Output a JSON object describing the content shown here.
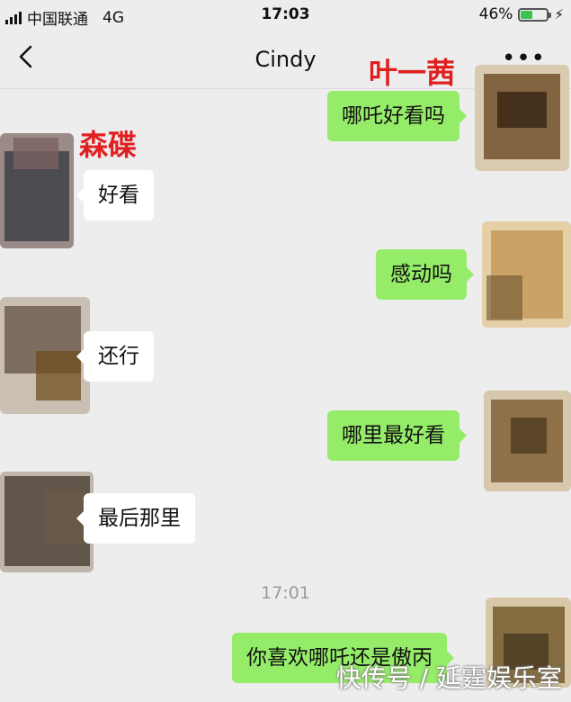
{
  "status_bar": {
    "carrier": "中国联通",
    "network": "4G",
    "time": "17:03",
    "battery_text": "46%",
    "battery_level": 0.46
  },
  "header": {
    "title": "Cindy",
    "back_icon": "chevron-left-icon",
    "more_icon": "more-dots-icon"
  },
  "annotations": {
    "left_name": "森碟",
    "right_name": "叶一茜"
  },
  "messages": [
    {
      "side": "right",
      "text": "哪吒好看吗"
    },
    {
      "side": "left",
      "text": "好看"
    },
    {
      "side": "right",
      "text": "感动吗"
    },
    {
      "side": "left",
      "text": "还行"
    },
    {
      "side": "right",
      "text": "哪里最好看"
    },
    {
      "side": "left",
      "text": "最后那里"
    },
    {
      "side": "right",
      "text": "你喜欢哪吒还是傲丙"
    }
  ],
  "timestamp": "17:01",
  "watermark": "快传号 / 延霆娱乐室",
  "colors": {
    "background": "#ededed",
    "bubble_right": "#95ec69",
    "bubble_left": "#ffffff",
    "annotation": "#e02020"
  }
}
